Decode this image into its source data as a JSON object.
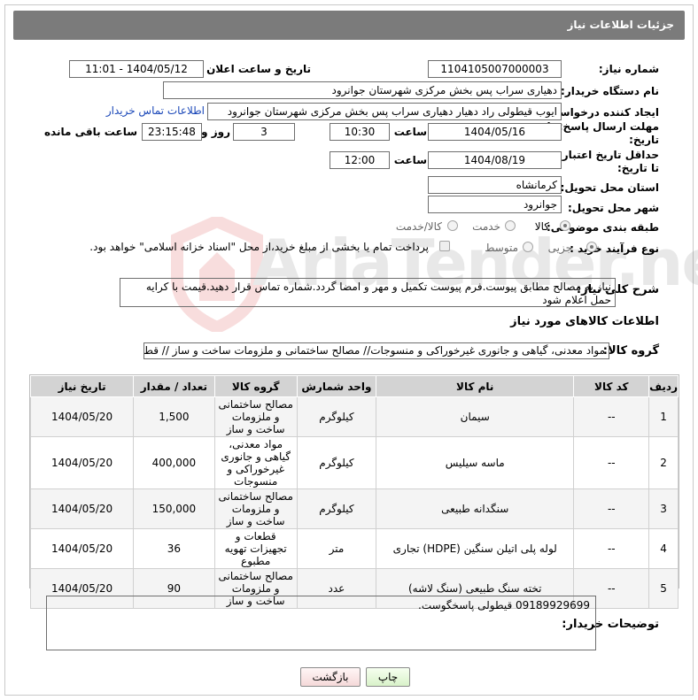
{
  "header": {
    "title": "جزئیات اطلاعات نیاز"
  },
  "fields": {
    "need_number_label": "شماره نیاز:",
    "need_number": "1104105007000003",
    "announce_label": "تاریخ و ساعت اعلان عمومی:",
    "announce_value": "1404/05/12 - 11:01",
    "buyer_label": "نام دستگاه خریدار:",
    "buyer_value": "دهیاری سراب پس بخش مرکزی شهرستان جوانرود",
    "creator_label": "ایجاد کننده درخواست:",
    "creator_value": "ایوب قیطولی راد دهیار دهیاری سراب پس بخش مرکزی شهرستان جوانرود",
    "buyer_contact_link": "اطلاعات تماس خریدار",
    "deadline_label_1": "مهلت ارسال پاسخ: تا",
    "deadline_label_2": "تاریخ:",
    "deadline_date": "1404/05/16",
    "time_label": "ساعت",
    "deadline_time": "10:30",
    "days_value": "3",
    "days_label": "روز و",
    "remaining_value": "23:15:48",
    "remaining_label": "ساعت باقی مانده",
    "validity_label_1": "حداقل تاریخ اعتبار قیمت:",
    "validity_label_2": "تا تاریخ:",
    "validity_date": "1404/08/19",
    "validity_time": "12:00",
    "province_label": "استان محل تحویل:",
    "province_value": "کرمانشاه",
    "city_label": "شهر محل تحویل:",
    "city_value": "جوانرود",
    "category_label": "طبقه بندی موضوعی:",
    "category_options": [
      "کالا",
      "خدمت",
      "کالا/خدمت"
    ],
    "category_selected": "کالا",
    "process_label": "نوع فرآیند خرید :",
    "process_options": [
      "جزیی",
      "متوسط"
    ],
    "payment_note": "پرداخت تمام یا بخشی از مبلغ خرید،از محل \"اسناد خزانه اسلامی\" خواهد بود.",
    "description_label": "شرح کلی نیاز:",
    "description_value": "نیاز به مصالح مطابق پیوست.فرم پیوست تکمیل و مهر و امضا گردد.شماره تماس قرار دهید.قیمت با کرایه حمل اعلام شود",
    "goods_section_title": "اطلاعات کالاهای مورد نیاز",
    "goods_group_label": "گروه کالا:",
    "goods_group_value": "مواد معدنی، گیاهی و جانوری غیرخوراکی و منسوجات// مصالح ساختمانی و ملزومات ساخت و ساز // قطعات"
  },
  "table": {
    "headers": [
      "ردیف",
      "کد کالا",
      "نام کالا",
      "واحد شمارش",
      "گروه کالا",
      "تعداد / مقدار",
      "تاریخ نیاز"
    ],
    "rows": [
      {
        "idx": "1",
        "code": "--",
        "name": "سیمان",
        "unit": "کیلوگرم",
        "group": "مصالح ساختمانی و ملزومات ساخت و ساز",
        "qty": "1,500",
        "date": "1404/05/20"
      },
      {
        "idx": "2",
        "code": "--",
        "name": "ماسه سیلیس",
        "unit": "کیلوگرم",
        "group": "مواد معدنی، گیاهی و جانوری غیرخوراکی و منسوجات",
        "qty": "400,000",
        "date": "1404/05/20"
      },
      {
        "idx": "3",
        "code": "--",
        "name": "سنگدانه طبیعی",
        "unit": "کیلوگرم",
        "group": "مصالح ساختمانی و ملزومات ساخت و ساز",
        "qty": "150,000",
        "date": "1404/05/20"
      },
      {
        "idx": "4",
        "code": "--",
        "name": "لوله پلی اتیلن سنگین (HDPE) تجاری",
        "unit": "متر",
        "group": "قطعات و تجهیزات تهویه مطبوع",
        "qty": "36",
        "date": "1404/05/20"
      },
      {
        "idx": "5",
        "code": "--",
        "name": "تخته سنگ طبیعی (سنگ لاشه)",
        "unit": "عدد",
        "group": "مصالح ساختمانی و ملزومات ساخت و ساز",
        "qty": "90",
        "date": "1404/05/20"
      }
    ]
  },
  "notes": {
    "label": "توضیحات خریدار:",
    "value": "09189929699 قیطولی پاسخگوست."
  },
  "buttons": {
    "print": "چاپ",
    "back": "بازگشت"
  },
  "watermark": {
    "text": "AriaTender.neT"
  }
}
